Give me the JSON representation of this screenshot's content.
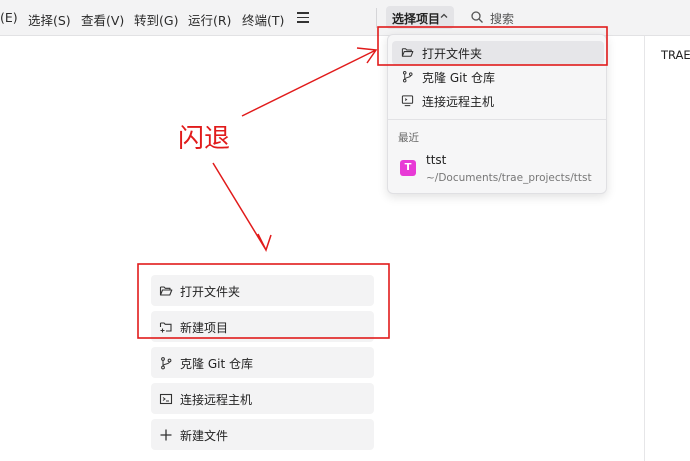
{
  "menubar": {
    "items": [
      {
        "label": "(E)"
      },
      {
        "label": "选择(S)"
      },
      {
        "label": "查看(V)"
      },
      {
        "label": "转到(G)"
      },
      {
        "label": "运行(R)"
      },
      {
        "label": "终端(T)"
      }
    ],
    "project_selector": "选择项目",
    "search_label": "搜索"
  },
  "right_panel": {
    "title": "TRAE"
  },
  "dropdown": {
    "items": [
      {
        "label": "打开文件夹",
        "icon": "folder-open-icon"
      },
      {
        "label": "克隆 Git 仓库",
        "icon": "git-branch-icon"
      },
      {
        "label": "连接远程主机",
        "icon": "remote-monitor-icon"
      }
    ],
    "recent_section": "最近",
    "recent": [
      {
        "badge": "T",
        "name": "ttst",
        "path": "~/Documents/trae_projects/ttst"
      }
    ]
  },
  "actions": [
    {
      "label": "打开文件夹",
      "icon": "folder-open-icon"
    },
    {
      "label": "新建项目",
      "icon": "new-project-icon"
    },
    {
      "label": "克隆 Git 仓库",
      "icon": "git-branch-icon"
    },
    {
      "label": "连接远程主机",
      "icon": "terminal-icon"
    },
    {
      "label": "新建文件",
      "icon": "plus-icon"
    }
  ],
  "annotation": {
    "text": "闪退",
    "color": "#e11b1b"
  },
  "colors": {
    "badge": "#e83ad6",
    "menubar_bg": "#f3f3f4",
    "action_bg": "#f3f3f4"
  }
}
